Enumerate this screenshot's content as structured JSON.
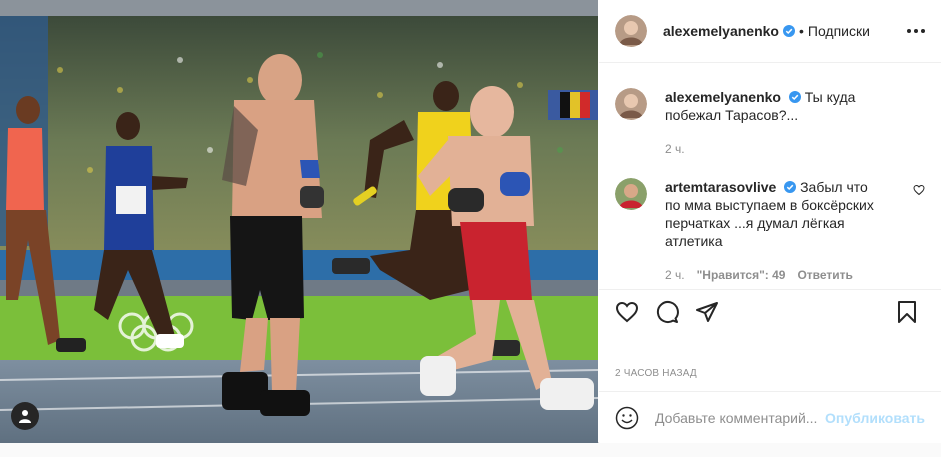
{
  "post": {
    "author": "alexemelyanenko",
    "follow_label": "Подписки",
    "separator": "•",
    "caption_user": "alexemelyanenko",
    "caption_text": "Ты куда побежал Тарасов?...",
    "caption_time": "2 ч.",
    "time_ago": "2 ЧАСОВ НАЗАД"
  },
  "reply": {
    "user": "artemtarasovlive",
    "text": "Забыл что по мма выступаем в боксёрских перчатках ...я думал лёгкая атлетика",
    "time": "2 ч.",
    "likes": "\"Нравится\": 49",
    "reply_label": "Ответить"
  },
  "comment_box": {
    "placeholder": "Добавьте комментарий...",
    "publish_label": "Опубликовать"
  },
  "icons": {
    "verified": "verified-badge-icon",
    "like": "heart-icon",
    "comment": "comment-icon",
    "share": "share-icon",
    "save": "bookmark-icon",
    "emoji": "emoji-icon",
    "more": "more-icon",
    "tag": "user-tag-icon"
  },
  "colors": {
    "accent": "#0095f6",
    "verified": "#3897f0",
    "muted": "#8e8e8e",
    "publish_disabled": "#b2dffc"
  }
}
